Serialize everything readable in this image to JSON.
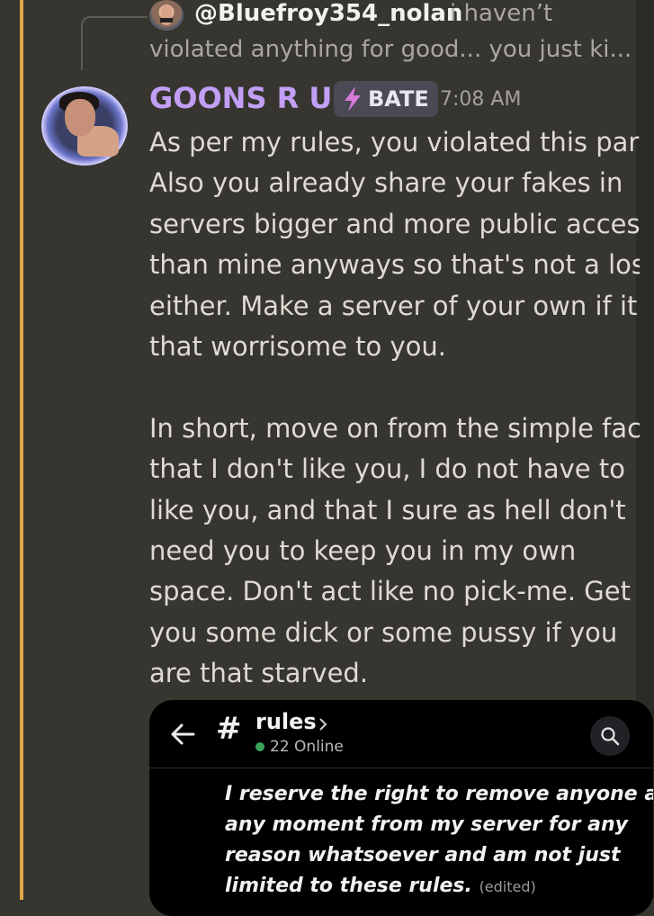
{
  "reply": {
    "username": "@Bluefroy354_nolan",
    "snippet_line1": "i haven’t",
    "snippet_line2": "violated anything for good... you just ki..."
  },
  "message": {
    "username": "GOONS R US",
    "role_tag": "BATE",
    "timestamp": "7:08 AM",
    "lines": [
      "As per my rules, you violated this part",
      "Also you already share your fakes in",
      "servers bigger and more public access",
      "than mine anyways so that's not a loss",
      "either. Make a server of your own if it's",
      "that worrisome to you.",
      "",
      "In short, move on from the simple fact",
      "that I don't like you, I do not have to",
      "like you, and that I sure as hell don't",
      "need you to keep you in my own",
      "space. Don't act like no pick-me. Get",
      "you some dick or some pussy if you",
      "are that starved."
    ]
  },
  "embed": {
    "channel_name": "rules",
    "online_count": "22 Online",
    "rule_lines": [
      "I reserve the right to remove anyone at",
      "any moment from my server for any",
      "reason whatsoever and am not just",
      "limited to these rules."
    ],
    "edited_label": "(edited)"
  },
  "colors": {
    "background": "#37352f",
    "username": "#c29ff5",
    "mention_highlight": "#e0a84a",
    "online_indicator": "#3ba55c"
  },
  "icons": [
    "lightning-bolt-icon",
    "back-arrow-icon",
    "hash-icon",
    "chevron-right-icon",
    "search-icon"
  ]
}
